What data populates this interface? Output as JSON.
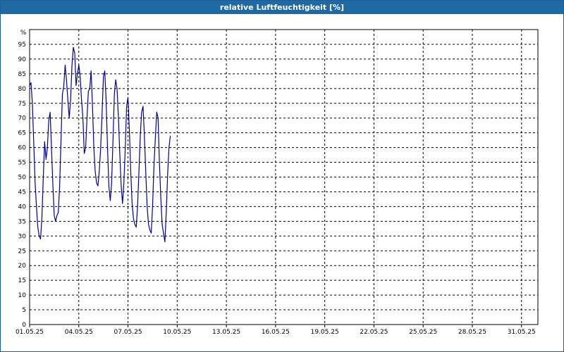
{
  "window": {
    "title": "relative Luftfeuchtigkeit [%]"
  },
  "colors": {
    "titlebar": "#1f6aa5",
    "series": "#000099",
    "grid": "#000000"
  },
  "chart_data": {
    "type": "line",
    "title": "relative Luftfeuchtigkeit [%]",
    "ylabel": "%",
    "xlabel": "",
    "ylim": [
      0,
      100
    ],
    "xlim": [
      "01.05.25",
      "01.06.25"
    ],
    "grid": true,
    "legend": "none",
    "yticks": [
      0,
      5,
      10,
      15,
      20,
      25,
      30,
      35,
      40,
      45,
      50,
      55,
      60,
      65,
      70,
      75,
      80,
      85,
      90,
      95
    ],
    "xticks": [
      "01.05.25",
      "04.05.25",
      "07.05.25",
      "10.05.25",
      "13.05.25",
      "16.05.25",
      "19.05.25",
      "22.05.25",
      "25.05.25",
      "28.05.25",
      "31.05.25"
    ],
    "series": [
      {
        "points": [
          [
            "01.05.25 00:00",
            81
          ],
          [
            "01.05.25 02:00",
            82
          ],
          [
            "01.05.25 04:00",
            75
          ],
          [
            "01.05.25 06:00",
            62
          ],
          [
            "01.05.25 08:00",
            48
          ],
          [
            "01.05.25 10:00",
            40
          ],
          [
            "01.05.25 12:00",
            33
          ],
          [
            "01.05.25 14:00",
            30
          ],
          [
            "01.05.25 16:00",
            29
          ],
          [
            "01.05.25 18:00",
            36
          ],
          [
            "01.05.25 20:00",
            50
          ],
          [
            "01.05.25 22:00",
            62
          ],
          [
            "02.05.25 00:00",
            56
          ],
          [
            "02.05.25 02:00",
            60
          ],
          [
            "02.05.25 04:00",
            69
          ],
          [
            "02.05.25 06:00",
            72
          ],
          [
            "02.05.25 08:00",
            60
          ],
          [
            "02.05.25 10:00",
            48
          ],
          [
            "02.05.25 12:00",
            37
          ],
          [
            "02.05.25 14:00",
            35
          ],
          [
            "02.05.25 16:00",
            37
          ],
          [
            "02.05.25 18:00",
            38
          ],
          [
            "02.05.25 20:00",
            47
          ],
          [
            "02.05.25 22:00",
            63
          ],
          [
            "03.05.25 00:00",
            78
          ],
          [
            "03.05.25 02:00",
            81
          ],
          [
            "03.05.25 04:00",
            88
          ],
          [
            "03.05.25 06:00",
            83
          ],
          [
            "03.05.25 08:00",
            76
          ],
          [
            "03.05.25 10:00",
            70
          ],
          [
            "03.05.25 12:00",
            76
          ],
          [
            "03.05.25 14:00",
            88
          ],
          [
            "03.05.25 16:00",
            94
          ],
          [
            "03.05.25 18:00",
            92
          ],
          [
            "03.05.25 20:00",
            81
          ],
          [
            "03.05.25 22:00",
            85
          ],
          [
            "04.05.25 00:00",
            88
          ],
          [
            "04.05.25 02:00",
            84
          ],
          [
            "04.05.25 04:00",
            76
          ],
          [
            "04.05.25 06:00",
            70
          ],
          [
            "04.05.25 08:00",
            58
          ],
          [
            "04.05.25 10:00",
            60
          ],
          [
            "04.05.25 12:00",
            70
          ],
          [
            "04.05.25 14:00",
            79
          ],
          [
            "04.05.25 16:00",
            80
          ],
          [
            "04.05.25 18:00",
            86
          ],
          [
            "04.05.25 20:00",
            74
          ],
          [
            "04.05.25 22:00",
            60
          ],
          [
            "05.05.25 00:00",
            52
          ],
          [
            "05.05.25 02:00",
            48
          ],
          [
            "05.05.25 04:00",
            47
          ],
          [
            "05.05.25 06:00",
            52
          ],
          [
            "05.05.25 08:00",
            60
          ],
          [
            "05.05.25 10:00",
            71
          ],
          [
            "05.05.25 12:00",
            84
          ],
          [
            "05.05.25 14:00",
            86
          ],
          [
            "05.05.25 16:00",
            76
          ],
          [
            "05.05.25 18:00",
            60
          ],
          [
            "05.05.25 20:00",
            47
          ],
          [
            "05.05.25 22:00",
            42
          ],
          [
            "06.05.25 00:00",
            48
          ],
          [
            "06.05.25 02:00",
            62
          ],
          [
            "06.05.25 04:00",
            78
          ],
          [
            "06.05.25 06:00",
            83
          ],
          [
            "06.05.25 08:00",
            80
          ],
          [
            "06.05.25 10:00",
            70
          ],
          [
            "06.05.25 12:00",
            58
          ],
          [
            "06.05.25 14:00",
            47
          ],
          [
            "06.05.25 16:00",
            41
          ],
          [
            "06.05.25 18:00",
            48
          ],
          [
            "06.05.25 20:00",
            60
          ],
          [
            "06.05.25 22:00",
            74
          ],
          [
            "07.05.25 00:00",
            77
          ],
          [
            "07.05.25 02:00",
            66
          ],
          [
            "07.05.25 04:00",
            52
          ],
          [
            "07.05.25 06:00",
            41
          ],
          [
            "07.05.25 08:00",
            36
          ],
          [
            "07.05.25 10:00",
            34
          ],
          [
            "07.05.25 12:00",
            33
          ],
          [
            "07.05.25 14:00",
            40
          ],
          [
            "07.05.25 16:00",
            52
          ],
          [
            "07.05.25 18:00",
            64
          ],
          [
            "07.05.25 20:00",
            72
          ],
          [
            "07.05.25 22:00",
            74
          ],
          [
            "08.05.25 00:00",
            64
          ],
          [
            "08.05.25 02:00",
            52
          ],
          [
            "08.05.25 04:00",
            40
          ],
          [
            "08.05.25 06:00",
            34
          ],
          [
            "08.05.25 08:00",
            32
          ],
          [
            "08.05.25 10:00",
            31
          ],
          [
            "08.05.25 12:00",
            40
          ],
          [
            "08.05.25 14:00",
            54
          ],
          [
            "08.05.25 16:00",
            63
          ],
          [
            "08.05.25 18:00",
            72
          ],
          [
            "08.05.25 20:00",
            70
          ],
          [
            "08.05.25 22:00",
            55
          ],
          [
            "09.05.25 00:00",
            43
          ],
          [
            "09.05.25 02:00",
            34
          ],
          [
            "09.05.25 04:00",
            31
          ],
          [
            "09.05.25 06:00",
            28
          ],
          [
            "09.05.25 08:00",
            38
          ],
          [
            "09.05.25 10:00",
            51
          ],
          [
            "09.05.25 12:00",
            60
          ],
          [
            "09.05.25 14:00",
            64
          ]
        ]
      }
    ]
  }
}
